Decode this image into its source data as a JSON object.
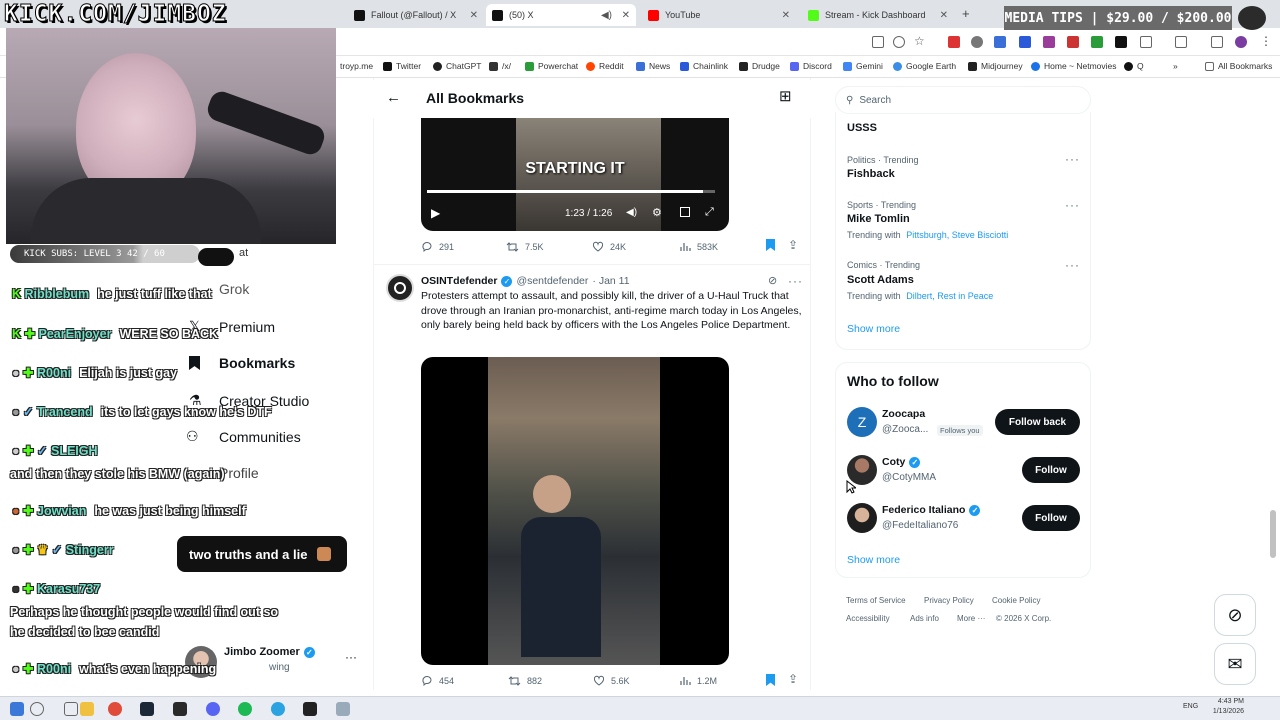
{
  "browser": {
    "tabs": [
      {
        "label": "Fallout (@Fallout) / X",
        "color": "#111111"
      },
      {
        "label": "(50) X",
        "color": "#111111"
      },
      {
        "label": "YouTube",
        "color": "#ff0000"
      },
      {
        "label": "Stream - Kick Dashboard",
        "color": "#53fc18"
      }
    ],
    "new_tab": "+",
    "bookmarks": [
      {
        "label": "troyp.me",
        "color": "#888888"
      },
      {
        "label": "Twitter",
        "color": "#111111"
      },
      {
        "label": "ChatGPT",
        "color": "#222222"
      },
      {
        "label": "/x/",
        "color": "#333333"
      },
      {
        "label": "Powerchat",
        "color": "#2a9d3a"
      },
      {
        "label": "Reddit",
        "color": "#ff4500"
      },
      {
        "label": "News",
        "color": "#3b6fd8"
      },
      {
        "label": "Chainlink",
        "color": "#2a5ada"
      },
      {
        "label": "Drudge",
        "color": "#222222"
      },
      {
        "label": "Discord",
        "color": "#5865f2"
      },
      {
        "label": "Gemini",
        "color": "#4285f4"
      },
      {
        "label": "Google Earth",
        "color": "#3a8ee6"
      },
      {
        "label": "Midjourney",
        "color": "#222222"
      },
      {
        "label": "Home ~ Netmovies",
        "color": "#1a73e8"
      },
      {
        "label": "Q",
        "color": "#111111"
      }
    ],
    "all_bookmarks": "All Bookmarks"
  },
  "stream": {
    "title": "KICK.COM/JIMBOZ",
    "media_tips": "MEDIA TIPS | $29.00 / $200.00",
    "subs": "KICK SUBS: LEVEL 3 42 / 60",
    "popup": "two truths and a lie",
    "chat": [
      {
        "user": "Ribblebum",
        "msg": "he just tuff like that"
      },
      {
        "user": "PearEnjoyer",
        "msg": "WERE SO BACK"
      },
      {
        "user": "R00ni",
        "msg": "Elijah is just gay"
      },
      {
        "user": "Trancend",
        "msg": "its to let gays know he's DTF"
      },
      {
        "user": "SLEIGH",
        "msg": ""
      },
      {
        "user": "",
        "msg": "and then they stole his BMW (again)"
      },
      {
        "user": "Jowvian",
        "msg": "he was just being himself"
      },
      {
        "user": "Stingerr",
        "msg": "two truths and a lie"
      },
      {
        "user": "Karasu737",
        "msg": ""
      },
      {
        "user": "",
        "msg": "Perhaps he thought people would find out so"
      },
      {
        "user": "",
        "msg": "he decided to bee candid"
      },
      {
        "user": "R00ni",
        "msg": "what's even happening"
      }
    ]
  },
  "nav": {
    "grok": "Grok",
    "premium": "Premium",
    "bookmarks": "Bookmarks",
    "creator_studio": "Creator Studio",
    "communities": "Communities",
    "profile": "Profile",
    "account_name": "Jimbo Zoomer",
    "account_sub": "wing"
  },
  "header": {
    "title": "All Bookmarks"
  },
  "tweet1": {
    "caption": "STARTING IT",
    "time": "1:23 / 1:26",
    "replies": "291",
    "reposts": "7.5K",
    "likes": "24K",
    "views": "583K"
  },
  "tweet2": {
    "name": "OSINTdefender",
    "handle": "@sentdefender",
    "date": "· Jan 11",
    "text": "Protesters attempt to assault, and possibly kill, the driver of a U-Haul Truck that drove through an Iranian pro-monarchist, anti-regime march today in Los Angeles, only barely being held back by officers with the Los Angeles Police Department.",
    "replies": "454",
    "reposts": "882",
    "likes": "5.6K",
    "views": "1.2M"
  },
  "search": {
    "placeholder": "Search"
  },
  "trends": {
    "top": "USSS",
    "items": [
      {
        "category": "Politics · Trending",
        "name": "Fishback",
        "with_label": "",
        "with": ""
      },
      {
        "category": "Sports · Trending",
        "name": "Mike Tomlin",
        "with_label": "Trending with",
        "with": "Pittsburgh, Steve Bisciotti"
      },
      {
        "category": "Comics · Trending",
        "name": "Scott Adams",
        "with_label": "Trending with",
        "with": "Dilbert, Rest in Peace"
      }
    ],
    "show_more": "Show more"
  },
  "who_to_follow": {
    "title": "Who to follow",
    "accounts": [
      {
        "name": "Zoocapa",
        "handle": "@Zooca...",
        "badge": "Follows you",
        "button": "Follow back",
        "initial": "Z"
      },
      {
        "name": "Coty",
        "handle": "@CotyMMA",
        "badge": "",
        "button": "Follow",
        "initial": ""
      },
      {
        "name": "Federico Italiano",
        "handle": "@FedeItaliano76",
        "badge": "",
        "button": "Follow",
        "initial": ""
      }
    ],
    "show_more": "Show more"
  },
  "footer": {
    "links": [
      "Terms of Service",
      "Privacy Policy",
      "Cookie Policy",
      "Accessibility",
      "Ads info",
      "More ···",
      "© 2026 X Corp."
    ]
  },
  "taskbar": {
    "time": "4:43 PM",
    "date": "1/13/2026",
    "lang": "ENG"
  }
}
